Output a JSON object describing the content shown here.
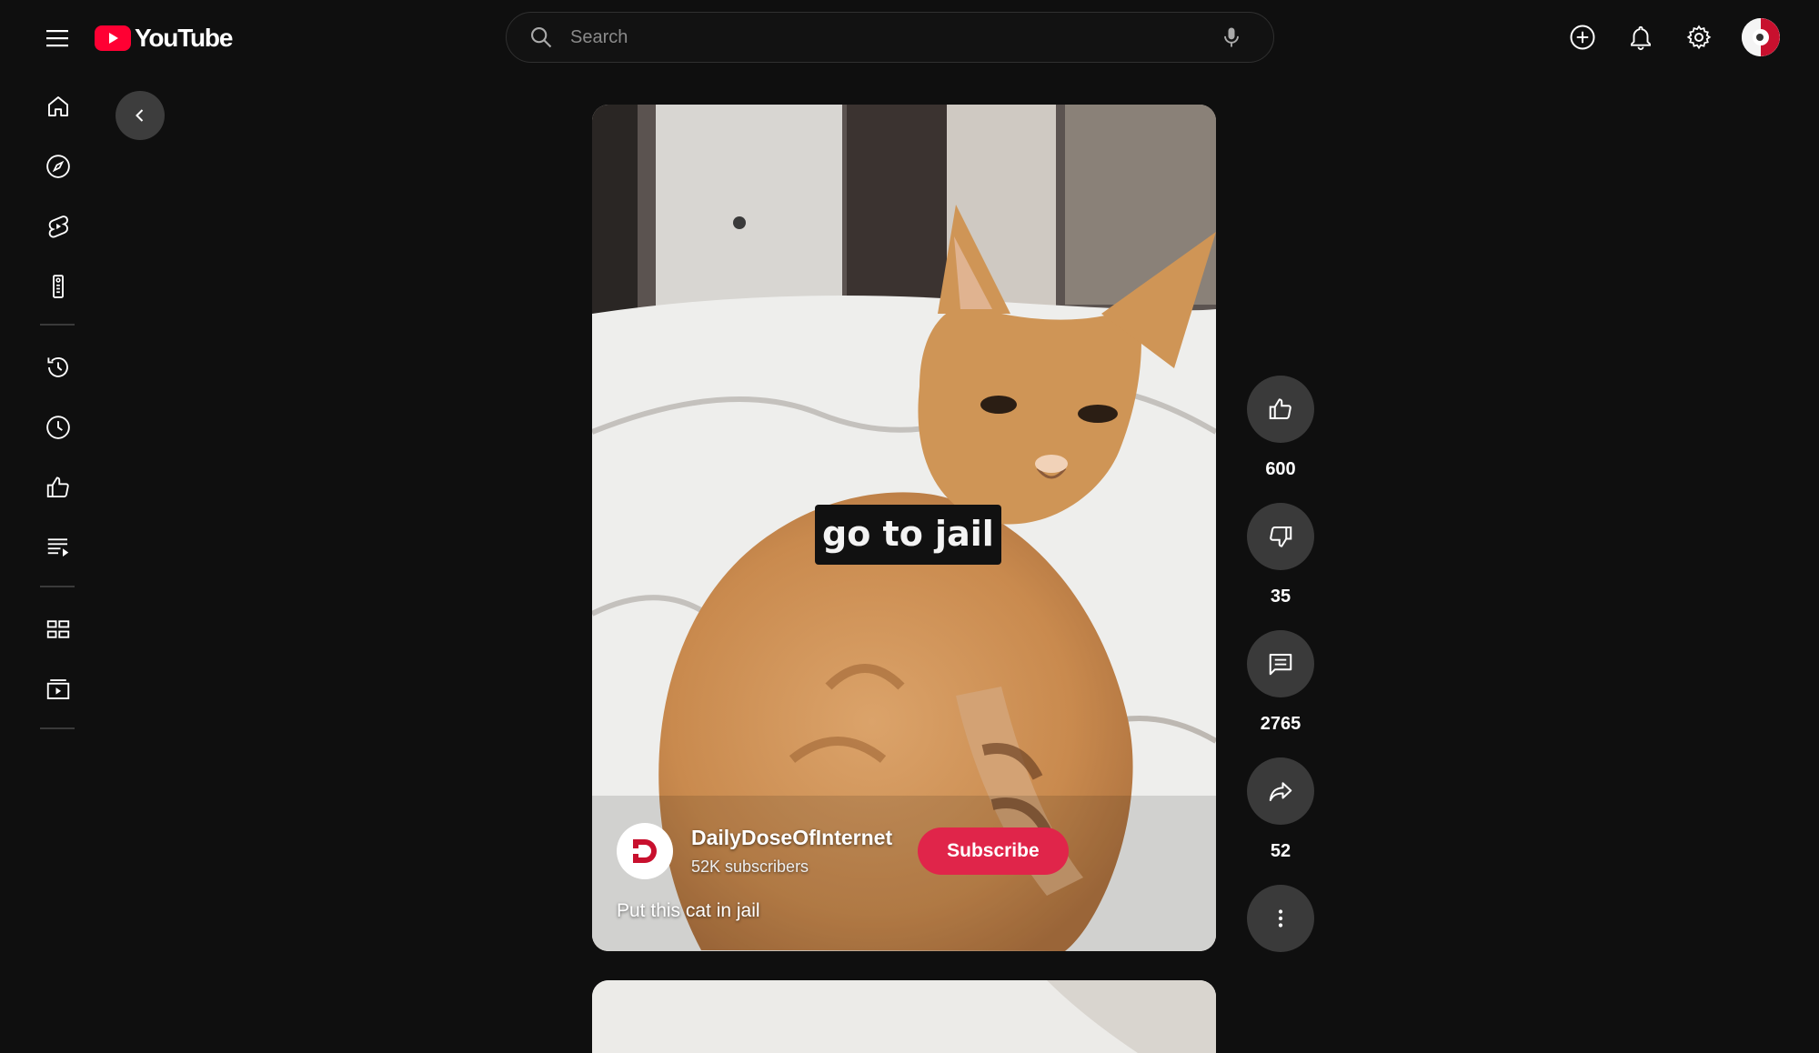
{
  "header": {
    "logo_text": "YouTube",
    "search_placeholder": "Search"
  },
  "icons": {
    "menu": "hamburger-icon",
    "search": "search-icon",
    "mic": "mic-icon",
    "create": "create-icon",
    "notifications": "bell-icon",
    "settings": "gear-icon"
  },
  "sidebar": {
    "items": [
      "home",
      "explore",
      "shorts",
      "subscriptions",
      "history",
      "watch-later",
      "liked-videos",
      "playlists",
      "library",
      "your-videos"
    ]
  },
  "short": {
    "caption": "go to jail",
    "channel_name": "DailyDoseOfInternet",
    "subscribers": "52K subscribers",
    "subscribe_label": "Subscribe",
    "title": "Put this cat in jail"
  },
  "actions": {
    "likes": "600",
    "dislikes": "35",
    "comments": "2765",
    "shares": "52"
  },
  "colors": {
    "background": "#0f0f0f",
    "brand_red": "#ff0033",
    "subscribe": "#e0254a",
    "action_button": "#3a3a3a"
  }
}
